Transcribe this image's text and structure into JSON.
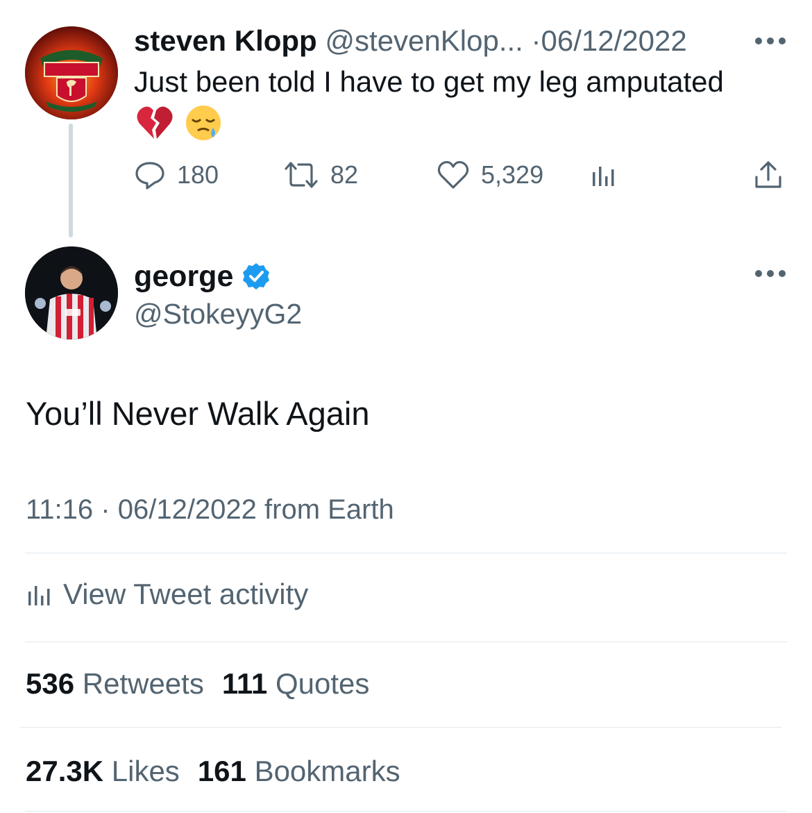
{
  "parent_tweet": {
    "display_name": "steven Klopp",
    "handle": "@stevenKlop...",
    "separator": "·",
    "date": "06/12/2022",
    "text": "Just been told I have to get my leg amputated",
    "emojis": [
      "broken-heart",
      "sleepy-face"
    ],
    "avatar_icon": "liverpool-crest",
    "actions": {
      "replies": "180",
      "retweets": "82",
      "likes": "5,329"
    }
  },
  "main_tweet": {
    "display_name": "george",
    "verified_icon": "verified-badge",
    "handle": "@StokeyyG2",
    "avatar_icon": "player-photo",
    "text": "You’ll Never Walk Again",
    "time": "11:16",
    "separator": "·",
    "date": "06/12/2022",
    "source": "from Earth",
    "activity_label": "View Tweet activity",
    "stats": {
      "retweets_count": "536",
      "retweets_label": "Retweets",
      "quotes_count": "111",
      "quotes_label": "Quotes",
      "likes_count": "27.3K",
      "likes_label": "Likes",
      "bookmarks_count": "161",
      "bookmarks_label": "Bookmarks"
    }
  },
  "colors": {
    "text_primary": "#0f1419",
    "text_secondary": "#536471",
    "verified_blue": "#1d9bf0",
    "divider": "#e1e8ed",
    "thread_line": "#cfd9de"
  }
}
